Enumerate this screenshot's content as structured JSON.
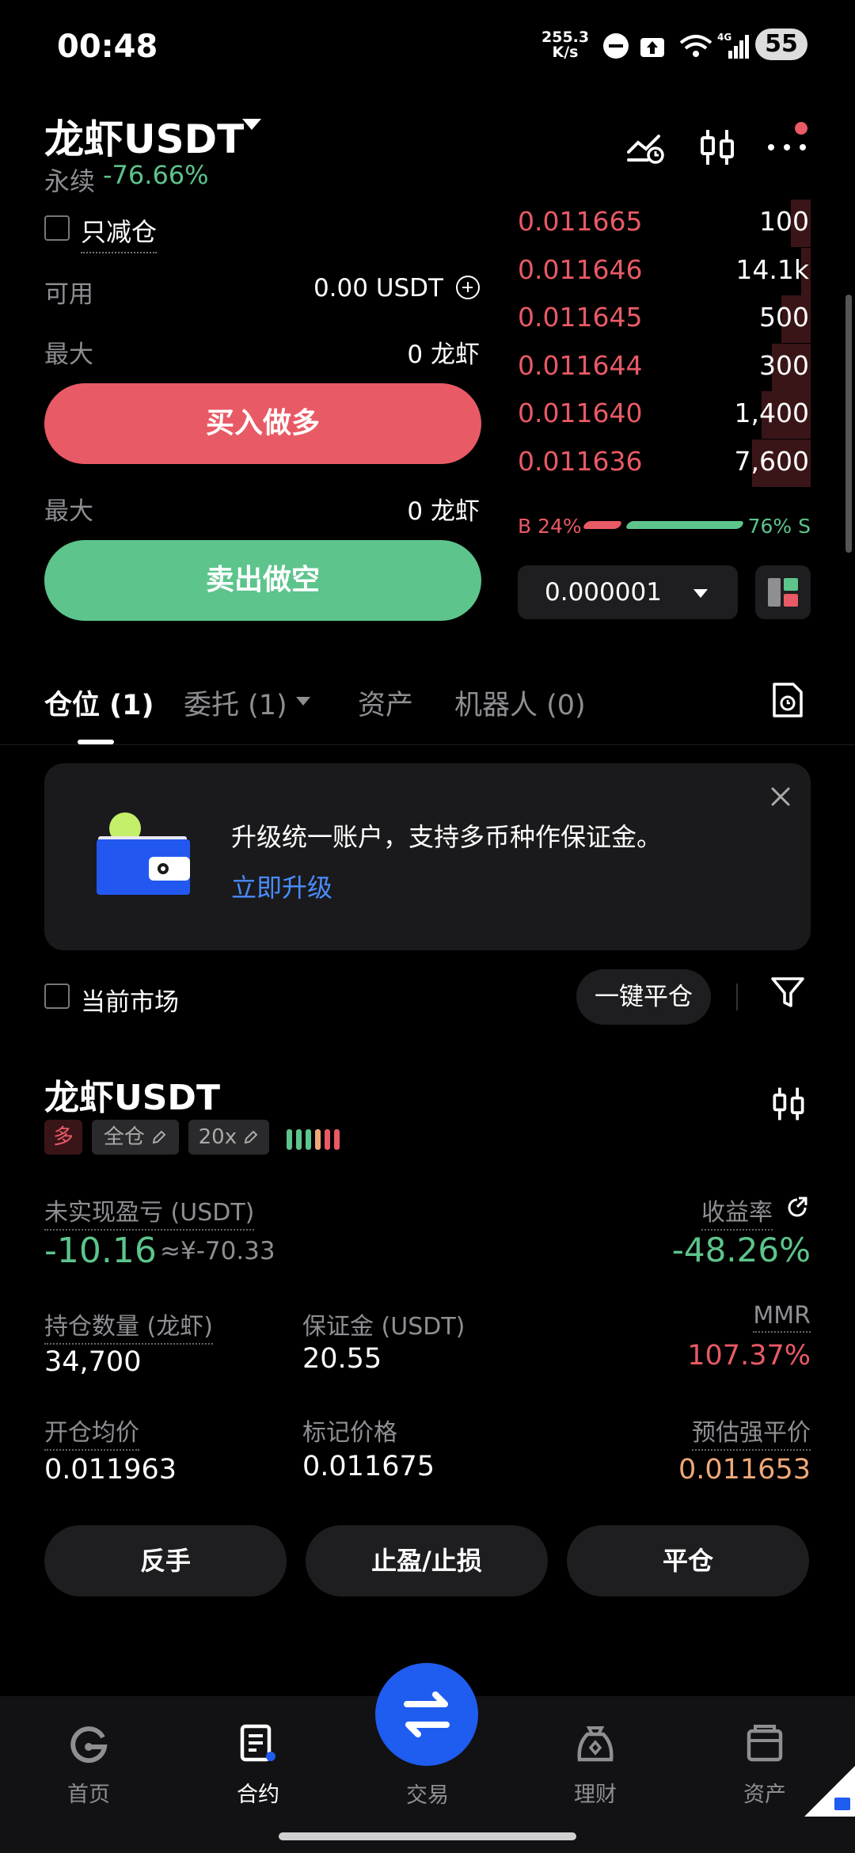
{
  "status_bar": {
    "time": "00:48",
    "net_speed": "255.3",
    "net_unit": "K/s",
    "signal": "4G",
    "battery": "55"
  },
  "header": {
    "title": "龙虾USDT",
    "contract_type": "永续",
    "change": "-76.66%"
  },
  "order_panel": {
    "reduce_only_label": "只减仓",
    "available_label": "可用",
    "available_value": "0.00 USDT",
    "max_label": "最大",
    "max_buy_value": "0 龙虾",
    "buy_label": "买入做多",
    "max_sell_value": "0 龙虾",
    "sell_label": "卖出做空"
  },
  "order_book": {
    "asks": [
      {
        "price": "0.011665",
        "qty": "100",
        "depth": 0.04
      },
      {
        "price": "0.011646",
        "qty": "14.1k",
        "depth": 0.02
      },
      {
        "price": "0.011645",
        "qty": "500",
        "depth": 0.06
      },
      {
        "price": "0.011644",
        "qty": "300",
        "depth": 0.08
      },
      {
        "price": "0.011640",
        "qty": "1,400",
        "depth": 0.1
      },
      {
        "price": "0.011636",
        "qty": "7,600",
        "depth": 0.12
      }
    ],
    "buy_ratio": "B 24%",
    "sell_ratio": "76% S",
    "precision": "0.000001"
  },
  "tabs": [
    {
      "label": "仓位 (1)"
    },
    {
      "label": "委托 (1)"
    },
    {
      "label": "资产"
    },
    {
      "label": "机器人 (0)"
    }
  ],
  "banner": {
    "text": "升级统一账户，支持多币种作保证金。",
    "link": "立即升级"
  },
  "filter": {
    "current_market_label": "当前市场",
    "close_all_label": "一键平仓"
  },
  "position": {
    "title": "龙虾USDT",
    "side_tag": "多",
    "margin_tag": "全仓",
    "leverage_tag": "20x",
    "pnl_label": "未实现盈亏 (USDT)",
    "pnl_value": "-10.16",
    "pnl_cny": "≈¥-70.33",
    "roe_label": "收益率",
    "roe_value": "-48.26%",
    "size_label": "持仓数量 (龙虾)",
    "size_value": "34,700",
    "margin_label": "保证金 (USDT)",
    "margin_value": "20.55",
    "mmr_label": "MMR",
    "mmr_value": "107.37%",
    "entry_label": "开仓均价",
    "entry_value": "0.011963",
    "mark_label": "标记价格",
    "mark_value": "0.011675",
    "liq_label": "预估强平价",
    "liq_value": "0.011653",
    "reverse_label": "反手",
    "tpsl_label": "止盈/止损",
    "close_label": "平仓"
  },
  "nav": [
    {
      "label": "首页",
      "icon": "home-icon"
    },
    {
      "label": "合约",
      "icon": "contract-icon"
    },
    {
      "label": "交易",
      "icon": "swap-icon"
    },
    {
      "label": "理财",
      "icon": "finance-icon"
    },
    {
      "label": "资产",
      "icon": "wallet-icon"
    }
  ],
  "colors": {
    "red": "#e85a65",
    "green": "#5dc48c",
    "blue": "#1f5cf0",
    "link": "#4a8cff",
    "orange": "#f0a878"
  }
}
